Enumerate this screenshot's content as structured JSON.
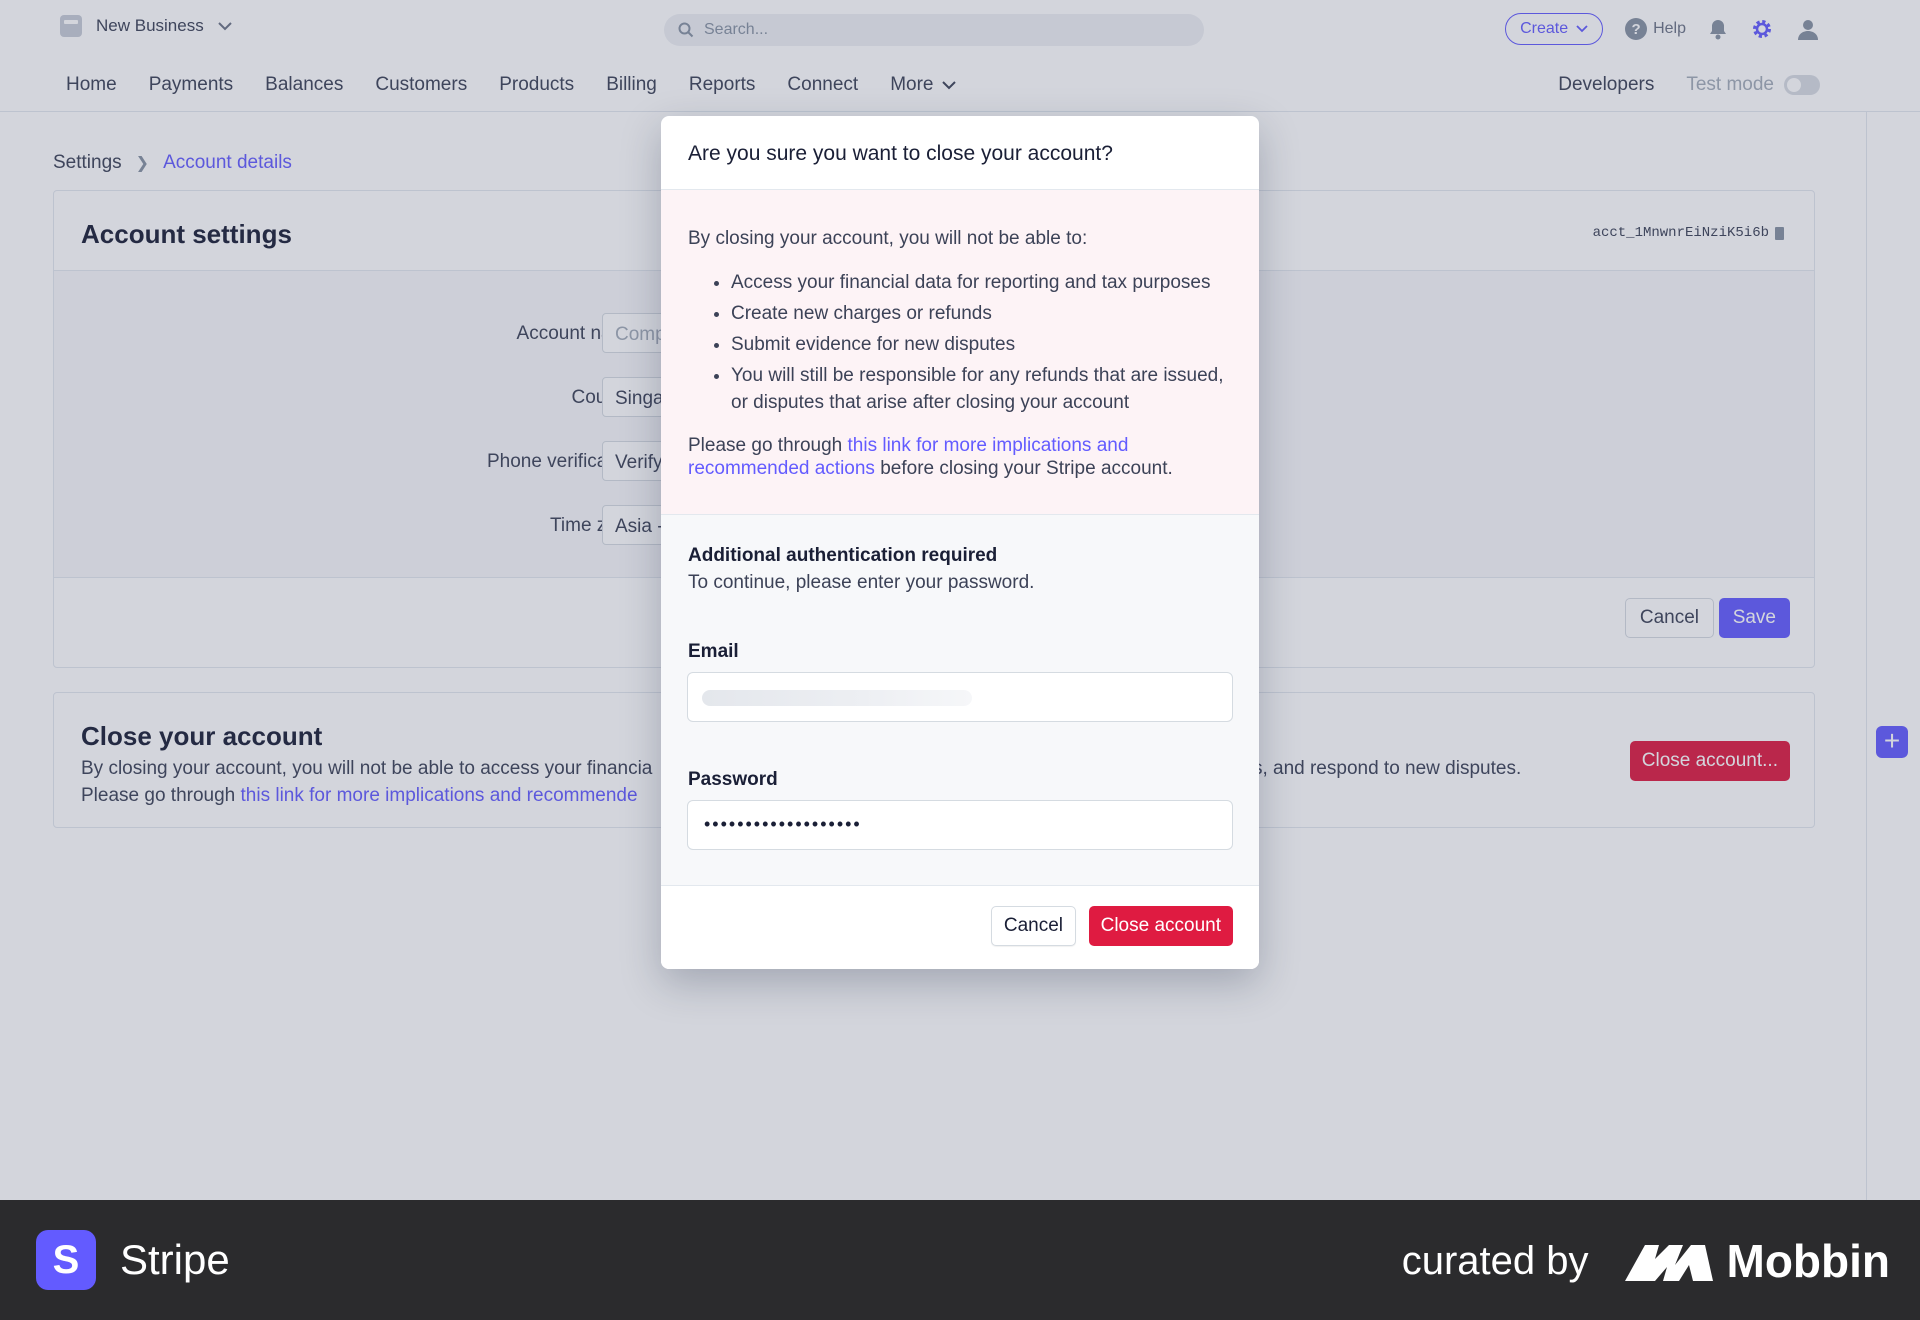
{
  "topbar": {
    "business_name": "New Business",
    "search_placeholder": "Search...",
    "create_label": "Create",
    "help_label": "Help"
  },
  "nav": {
    "items": [
      "Home",
      "Payments",
      "Balances",
      "Customers",
      "Products",
      "Billing",
      "Reports",
      "Connect"
    ],
    "more_label": "More",
    "developers_label": "Developers",
    "test_mode_label": "Test mode"
  },
  "breadcrumb": {
    "root": "Settings",
    "current": "Account details"
  },
  "account_settings": {
    "title": "Account settings",
    "account_id": "acct_1MnwnrEiNziK5i6b",
    "fields": [
      {
        "label": "Account name",
        "value": "Comp"
      },
      {
        "label": "Country",
        "value": "Singa"
      },
      {
        "label": "Phone verification",
        "value": "Verify"
      },
      {
        "label": "Time zone",
        "value": "Asia -"
      }
    ],
    "cancel_label": "Cancel",
    "save_label": "Save"
  },
  "close_section": {
    "title": "Close your account",
    "text_line1_start": "By closing your account, you will not be able to access your financia",
    "text_line1_end": "ds, and respond to new disputes.",
    "text_line2_start": "Please go through ",
    "text_line2_link": "this link for more implications and recommende",
    "button_label": "Close account..."
  },
  "modal": {
    "title": "Are you sure you want to close your account?",
    "intro": "By closing your account, you will not be able to:",
    "bullets": [
      "Access your financial data for reporting and tax purposes",
      "Create new charges or refunds",
      "Submit evidence for new disputes",
      "You will still be responsible for any refunds that are issued, or disputes that arise after closing your account"
    ],
    "note_prefix": "Please go through ",
    "note_link": "this link for more implications and recommended actions",
    "note_suffix": " before closing your Stripe account.",
    "auth_title": "Additional authentication required",
    "auth_subtitle": "To continue, please enter your password.",
    "email_label": "Email",
    "password_label": "Password",
    "password_value": "•••••••••••••••••••",
    "cancel_label": "Cancel",
    "confirm_label": "Close account"
  },
  "footer_banner": {
    "app_logo_letter": "S",
    "app_name": "Stripe",
    "curated_by": "curated by",
    "curator": "Mobbin"
  },
  "colors": {
    "accent": "#635bff",
    "danger": "#df1b41",
    "banner": "#2b2b2d"
  }
}
